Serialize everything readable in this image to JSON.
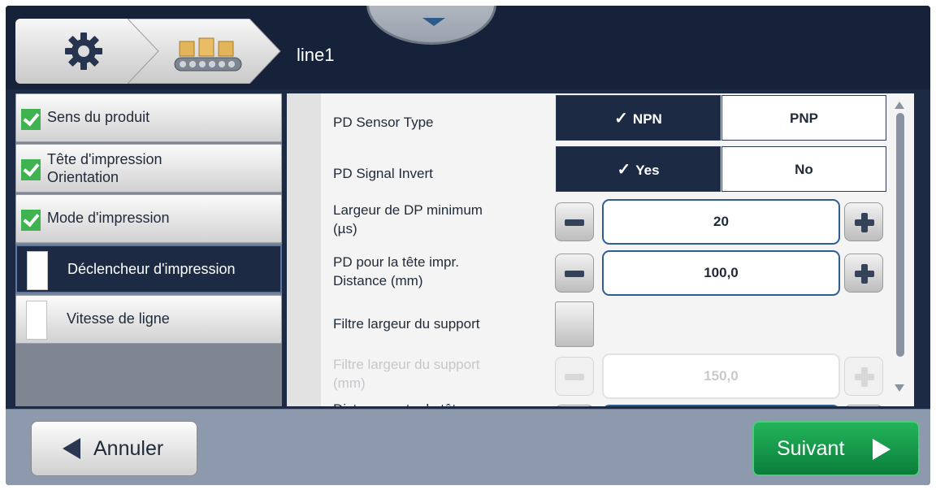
{
  "header": {
    "line_title": "line1",
    "home_icon": "gear-icon",
    "line_icon": "conveyor-icon"
  },
  "sidebar": {
    "items": [
      {
        "label": "Sens du produit",
        "state": "done"
      },
      {
        "label": "Tête d'impression\nOrientation",
        "state": "done"
      },
      {
        "label": "Mode d'impression",
        "state": "done"
      },
      {
        "label": "Déclencheur d'impression",
        "state": "current"
      },
      {
        "label": "Vitesse de ligne",
        "state": "pending"
      }
    ]
  },
  "settings": {
    "sensor_type": {
      "label": "PD Sensor Type",
      "options": [
        "NPN",
        "PNP"
      ],
      "selected": "NPN"
    },
    "signal_invert": {
      "label": "PD Signal Invert",
      "options": [
        "Yes",
        "No"
      ],
      "selected": "Yes"
    },
    "min_width": {
      "label": "Largeur de DP minimum\n(µs)",
      "value": "20"
    },
    "head_distance": {
      "label": "PD pour la tête impr.\nDistance  (mm)",
      "value": "100,0"
    },
    "media_filter": {
      "label": "Filtre largeur du support",
      "checked": false
    },
    "media_filter_width": {
      "label": "Filtre largeur du support\n(mm)",
      "value": "150,0",
      "disabled": true
    },
    "partial_next_label": "Distance entre la tête"
  },
  "footer": {
    "cancel_label": "Annuler",
    "next_label": "Suivant"
  },
  "colors": {
    "accent": "#1d2a44",
    "next_green": "#13994a",
    "check_green": "#3fb34f"
  }
}
